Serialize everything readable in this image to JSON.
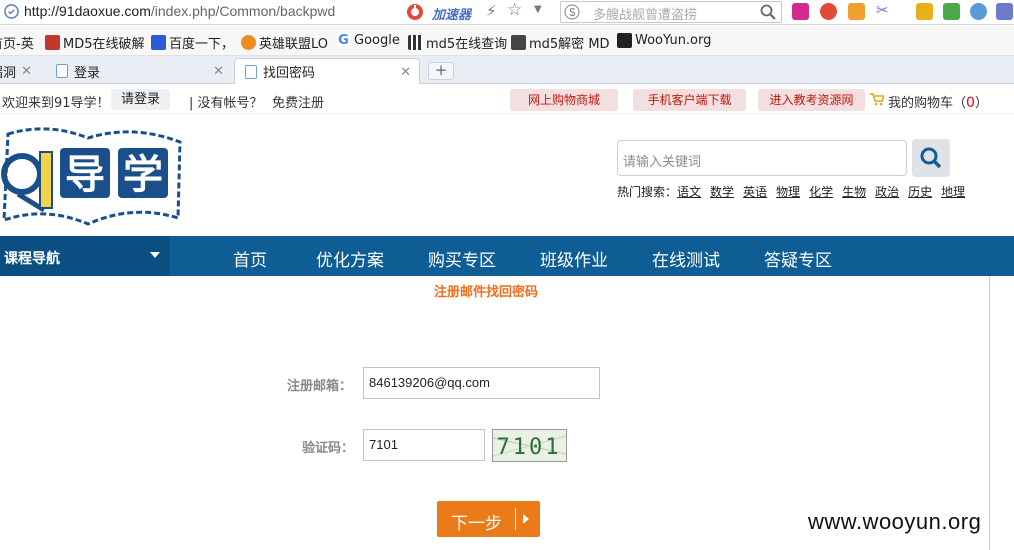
{
  "browser": {
    "url_prefix": "http://",
    "url_host": "91daoxue.com",
    "url_path": "/index.php/Common/backpwd",
    "accelerator_label": "加速器",
    "search_placeholder": "多艘战舰曾遭盗捞"
  },
  "bookmarks": [
    {
      "label": "首页-英",
      "icon": "page-icon"
    },
    {
      "label": "MD5在线破解",
      "icon": "md5-icon"
    },
    {
      "label": "百度一下，",
      "icon": "baidu-paw-icon"
    },
    {
      "label": "英雄联盟LO",
      "icon": "lol-icon"
    },
    {
      "label": "Google",
      "icon": "google-icon"
    },
    {
      "label": "md5在线查询",
      "icon": "grid-icon"
    },
    {
      "label": "md5解密 MD",
      "icon": "md5-decrypt-icon"
    },
    {
      "label": "WooYun.org",
      "icon": "wooyun-icon"
    }
  ],
  "tabs": [
    {
      "label": "漏洞"
    },
    {
      "label": "登录"
    },
    {
      "label": "找回密码"
    }
  ],
  "topbar": {
    "welcome": "欢迎来到91导学！",
    "login": "请登录",
    "no_account": "|  没有帐号？",
    "register": "免费注册",
    "shop": "网上购物商城",
    "mobile": "手机客户端下载",
    "edu": "进入教考资源网",
    "cart_label": "我的购物车（",
    "cart_count": "0",
    "cart_close": "）"
  },
  "logo": {
    "text": "91导学"
  },
  "site_search": {
    "placeholder": "请输入关键词"
  },
  "hot_search": {
    "label": "热门搜索：",
    "items": [
      "语文",
      "数学",
      "英语",
      "物理",
      "化学",
      "生物",
      "政治",
      "历史",
      "地理"
    ]
  },
  "nav": {
    "dropdown": "课程导航",
    "items": [
      "首页",
      "优化方案",
      "购买专区",
      "班级作业",
      "在线测试",
      "答疑专区"
    ]
  },
  "form": {
    "title": "注册邮件找回密码",
    "email_label": "注册邮箱：",
    "email_value": "846139206@qq.com",
    "code_label": "验证码：",
    "code_value": "7101",
    "captcha_text": "7101",
    "submit": "下一步"
  },
  "watermark": "www.wooyun.org",
  "colors": {
    "nav_bg": "#0e5d95",
    "accent_orange": "#eb7a19",
    "title_orange": "#f26e1b",
    "red": "#c1180b"
  }
}
